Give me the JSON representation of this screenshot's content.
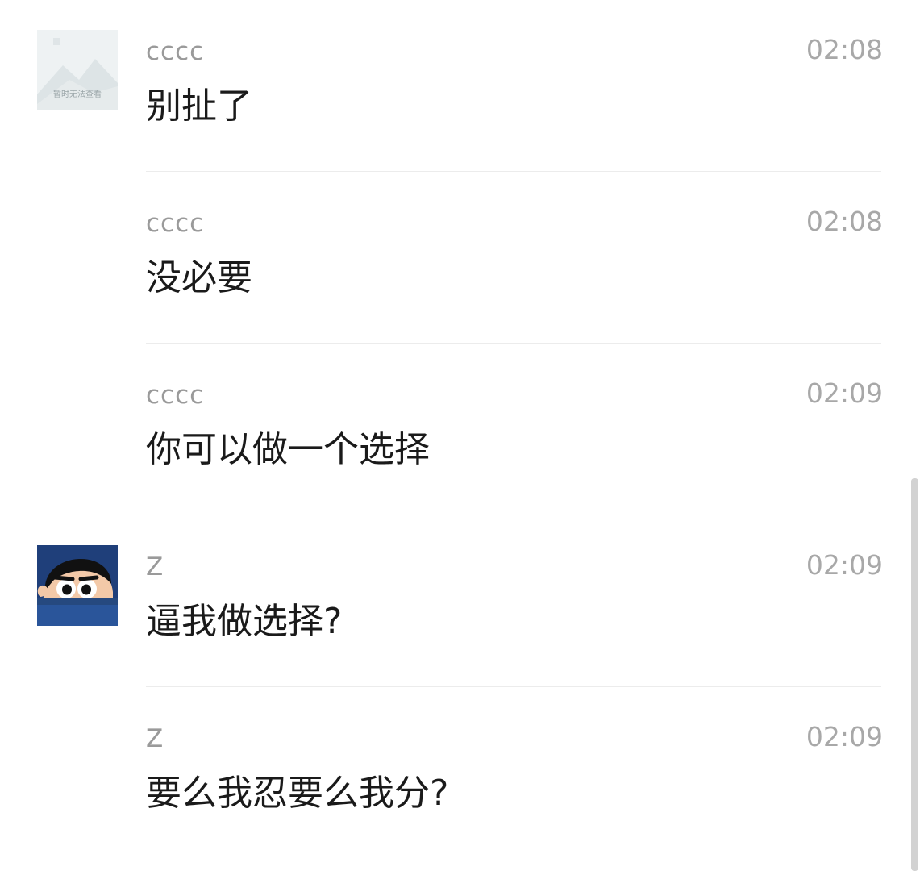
{
  "messages": [
    {
      "sender": "cccc",
      "time": "02:08",
      "text": "别扯了",
      "avatar": "image-placeholder"
    },
    {
      "sender": "cccc",
      "time": "02:08",
      "text": "没必要",
      "avatar": null
    },
    {
      "sender": "cccc",
      "time": "02:09",
      "text": "你可以做一个选择",
      "avatar": null
    },
    {
      "sender": "Z",
      "time": "02:09",
      "text": "逼我做选择?",
      "avatar": "cartoon-boy"
    },
    {
      "sender": "Z",
      "time": "02:09",
      "text": "要么我忍要么我分?",
      "avatar": null
    }
  ],
  "placeholder_avatar": {
    "caption": "暂时无法查看",
    "icon": "mountain-image-icon"
  },
  "colors": {
    "sender": "#9a9a9a",
    "time": "#a8a8a8",
    "text": "#1a1a1a",
    "divider": "#ececec",
    "background": "#ffffff"
  }
}
